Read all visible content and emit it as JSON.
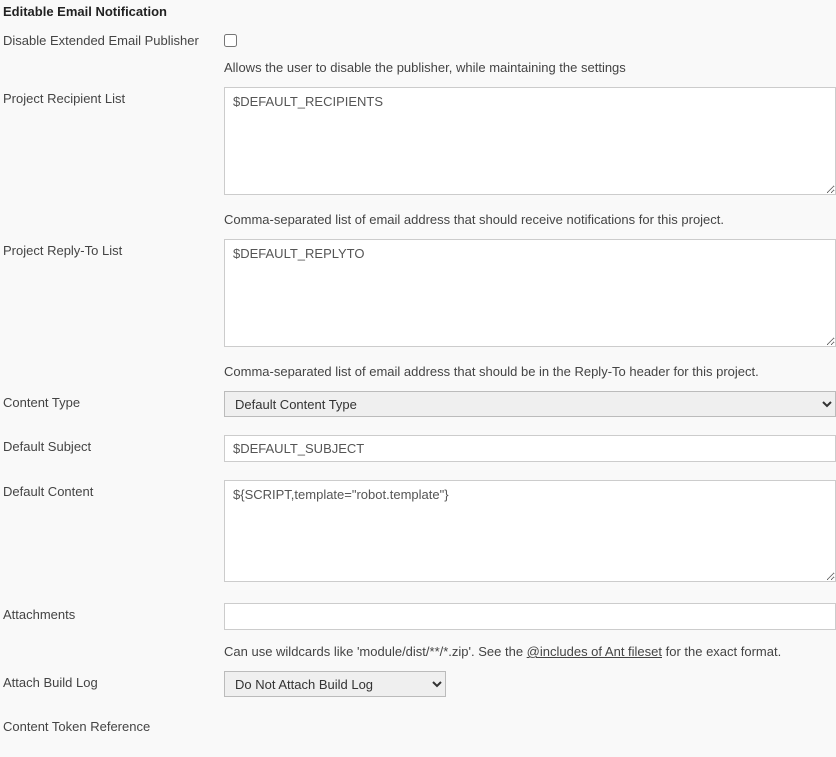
{
  "section": {
    "title": "Editable Email Notification"
  },
  "disable_publisher": {
    "label": "Disable Extended Email Publisher",
    "checked": false,
    "help": "Allows the user to disable the publisher, while maintaining the settings"
  },
  "recipient_list": {
    "label": "Project Recipient List",
    "value": "$DEFAULT_RECIPIENTS",
    "help": "Comma-separated list of email address that should receive notifications for this project."
  },
  "replyto_list": {
    "label": "Project Reply-To List",
    "value": "$DEFAULT_REPLYTO",
    "help": "Comma-separated list of email address that should be in the Reply-To header for this project."
  },
  "content_type": {
    "label": "Content Type",
    "value": "Default Content Type"
  },
  "default_subject": {
    "label": "Default Subject",
    "value": "$DEFAULT_SUBJECT"
  },
  "default_content": {
    "label": "Default Content",
    "value": "${SCRIPT,template=\"robot.template\"}"
  },
  "attachments": {
    "label": "Attachments",
    "value": "",
    "help_prefix": "Can use wildcards like 'module/dist/**/*.zip'. See the ",
    "help_link": "@includes of Ant fileset",
    "help_suffix": " for the exact format."
  },
  "attach_build_log": {
    "label": "Attach Build Log",
    "value": "Do Not Attach Build Log"
  },
  "content_token_ref": {
    "label": "Content Token Reference"
  }
}
